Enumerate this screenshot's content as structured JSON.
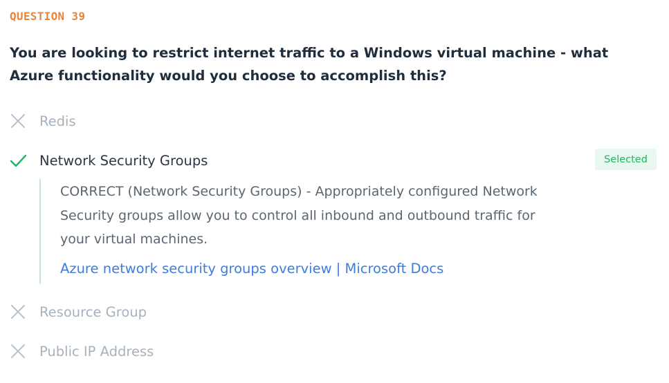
{
  "question": {
    "label": "QUESTION 39",
    "text": "You are looking to restrict internet traffic to a Windows virtual machine - what Azure functionality would you choose to accomplish this?"
  },
  "options": [
    {
      "label": "Redis",
      "status": "incorrect",
      "icon": "x-icon"
    },
    {
      "label": "Network Security Groups",
      "status": "correct",
      "icon": "check-icon",
      "badge": "Selected"
    },
    {
      "label": "Resource Group",
      "status": "incorrect",
      "icon": "x-icon"
    },
    {
      "label": "Public IP Address",
      "status": "incorrect",
      "icon": "x-icon"
    }
  ],
  "explanation": {
    "text": "CORRECT (Network Security Groups) - Appropriately configured Network Security groups allow you to control all inbound and outbound traffic for your virtual machines.",
    "link_text": "Azure network security groups overview | Microsoft Docs"
  },
  "colors": {
    "question_label": "#e8853a",
    "question_text": "#1f2d3d",
    "muted_option": "#a7b2bd",
    "selected_option": "#2b3642",
    "check": "#1fb566",
    "badge_bg": "#e8f8ef",
    "badge_text": "#1fb566",
    "explanation_border": "#c8e6cf",
    "explanation_text": "#5b6671",
    "link": "#3d7ddb"
  }
}
